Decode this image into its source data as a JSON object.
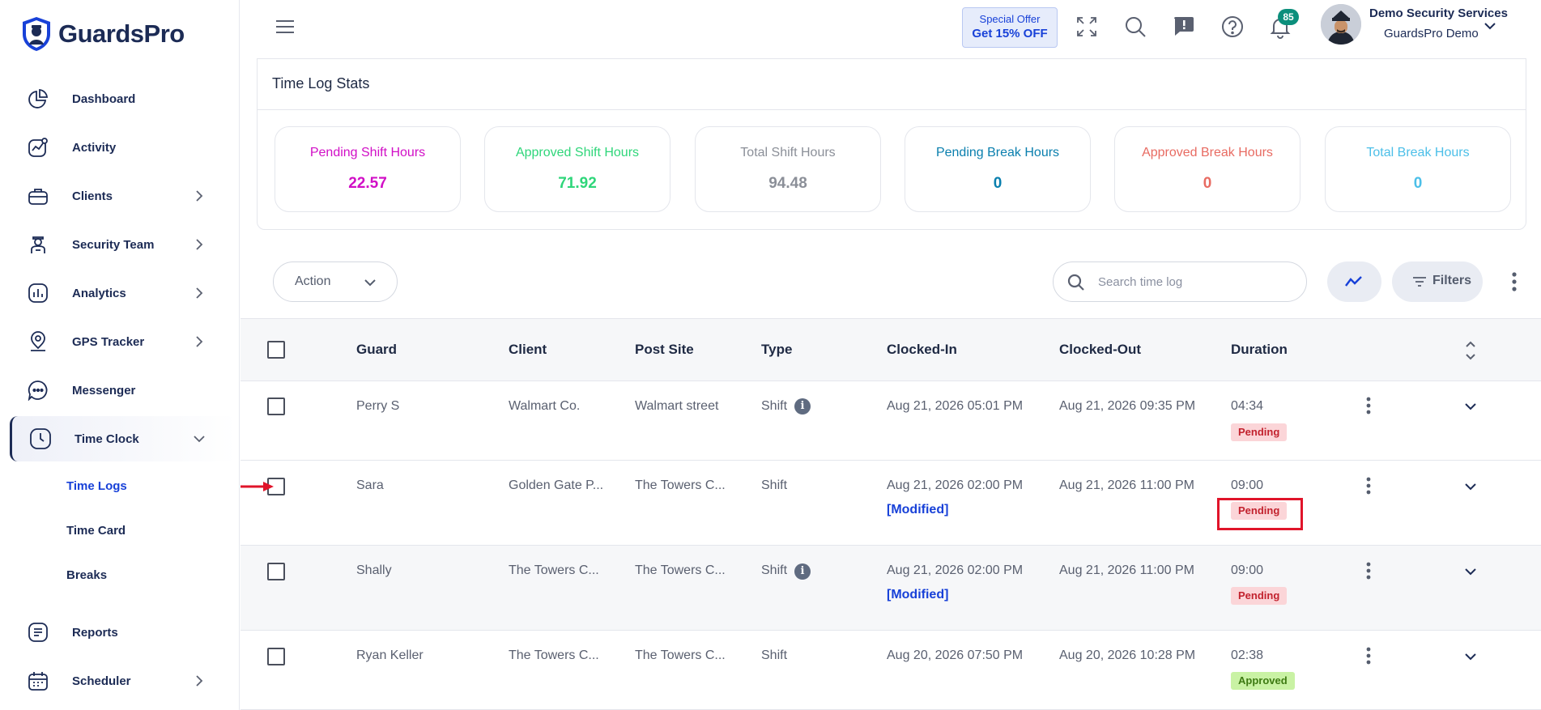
{
  "app": {
    "brand": "GuardsPro"
  },
  "sidebar": {
    "items": [
      {
        "label": "Dashboard",
        "icon": "pie-chart-icon"
      },
      {
        "label": "Activity",
        "icon": "activity-icon"
      },
      {
        "label": "Clients",
        "icon": "briefcase-icon"
      },
      {
        "label": "Security Team",
        "icon": "guard-icon"
      },
      {
        "label": "Analytics",
        "icon": "analytics-icon"
      },
      {
        "label": "GPS Tracker",
        "icon": "location-pin-icon"
      },
      {
        "label": "Messenger",
        "icon": "chat-bubble-icon"
      },
      {
        "label": "Time Clock",
        "icon": "clock-icon"
      },
      {
        "label": "Reports",
        "icon": "report-icon"
      },
      {
        "label": "Scheduler",
        "icon": "calendar-icon"
      }
    ],
    "time_clock_sub": [
      "Time Logs",
      "Time Card",
      "Breaks"
    ]
  },
  "topbar": {
    "offer_line1": "Special Offer",
    "offer_line2": "Get 15% OFF",
    "notification_count": "85",
    "user_name": "Demo Security Services",
    "user_org": "GuardsPro Demo"
  },
  "stats": {
    "title": "Time Log Stats",
    "cards": [
      {
        "label": "Pending Shift Hours",
        "value": "22.57",
        "color": "#d10fc6"
      },
      {
        "label": "Approved Shift Hours",
        "value": "71.92",
        "color": "#2fd67a"
      },
      {
        "label": "Total Shift Hours",
        "value": "94.48",
        "color": "#8b8f98"
      },
      {
        "label": "Pending Break Hours",
        "value": "0",
        "color": "#0a7fae"
      },
      {
        "label": "Approved Break Hours",
        "value": "0",
        "color": "#e86b62"
      },
      {
        "label": "Total Break Hours",
        "value": "0",
        "color": "#4cbfe8"
      }
    ]
  },
  "toolbar": {
    "action_label": "Action",
    "search_placeholder": "Search time log",
    "filters_label": "Filters"
  },
  "table": {
    "headers": [
      "Guard",
      "Client",
      "Post Site",
      "Type",
      "Clocked-In",
      "Clocked-Out",
      "Duration"
    ],
    "rows": [
      {
        "guard": "Perry S",
        "client": "Walmart Co.",
        "post_site": "Walmart street",
        "type": "Shift",
        "clocked_in": "Aug 21, 2026 05:01 PM",
        "clocked_out": "Aug 21, 2026 09:35 PM",
        "duration": "04:34",
        "status": "Pending"
      },
      {
        "guard": "Sara",
        "client": "Golden Gate P...",
        "post_site": "The Towers C...",
        "type": "Shift",
        "clocked_in": "Aug 21, 2026 02:00 PM",
        "modified": "[Modified]",
        "clocked_out": "Aug 21, 2026 11:00 PM",
        "duration": "09:00",
        "status": "Pending"
      },
      {
        "guard": "Shally",
        "client": "The Towers C...",
        "post_site": "The Towers C...",
        "type": "Shift",
        "clocked_in": "Aug 21, 2026 02:00 PM",
        "modified": "[Modified]",
        "clocked_out": "Aug 21, 2026 11:00 PM",
        "duration": "09:00",
        "status": "Pending"
      },
      {
        "guard": "Ryan Keller",
        "client": "The Towers C...",
        "post_site": "The Towers C...",
        "type": "Shift",
        "clocked_in": "Aug 20, 2026 07:50 PM",
        "clocked_out": "Aug 20, 2026 10:28 PM",
        "duration": "02:38",
        "status": "Approved"
      }
    ]
  },
  "colors": {
    "brand_navy": "#1c2b55",
    "link_blue": "#1841d8",
    "annotation_red": "#e0142a"
  }
}
